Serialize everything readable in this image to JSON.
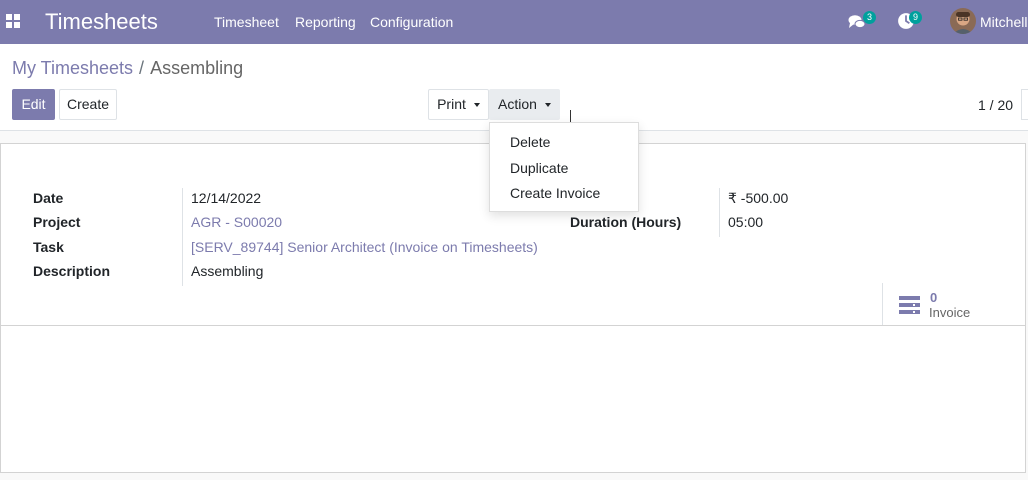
{
  "navbar": {
    "app_title": "Timesheets",
    "menu": [
      "Timesheet",
      "Reporting",
      "Configuration"
    ],
    "messages_count": "3",
    "activities_count": "9",
    "user_name": "Mitchell"
  },
  "breadcrumb": {
    "parent": "My Timesheets",
    "separator": "/",
    "current": "Assembling"
  },
  "toolbar": {
    "edit_label": "Edit",
    "create_label": "Create",
    "print_label": "Print",
    "action_label": "Action"
  },
  "pager": {
    "value": "1 / 20"
  },
  "action_menu": {
    "items": [
      "Delete",
      "Duplicate",
      "Create Invoice"
    ]
  },
  "form": {
    "date_label": "Date",
    "date_value": "12/14/2022",
    "project_label": "Project",
    "project_value": "AGR - S00020",
    "task_label": "Task",
    "task_value": "[SERV_89744] Senior Architect (Invoice on Timesheets)",
    "description_label": "Description",
    "description_value": "Assembling",
    "amount_value": "₹ -500.00",
    "duration_label": "Duration (Hours)",
    "duration_value": "05:00"
  },
  "smart_button": {
    "count": "0",
    "label": "Invoice"
  },
  "colors": {
    "brand": "#7c7bad",
    "badge": "#00a09d"
  },
  "icons": [
    "apps-grid-icon",
    "chat-bubbles-icon",
    "activity-clock-icon",
    "invoice-list-icon"
  ]
}
